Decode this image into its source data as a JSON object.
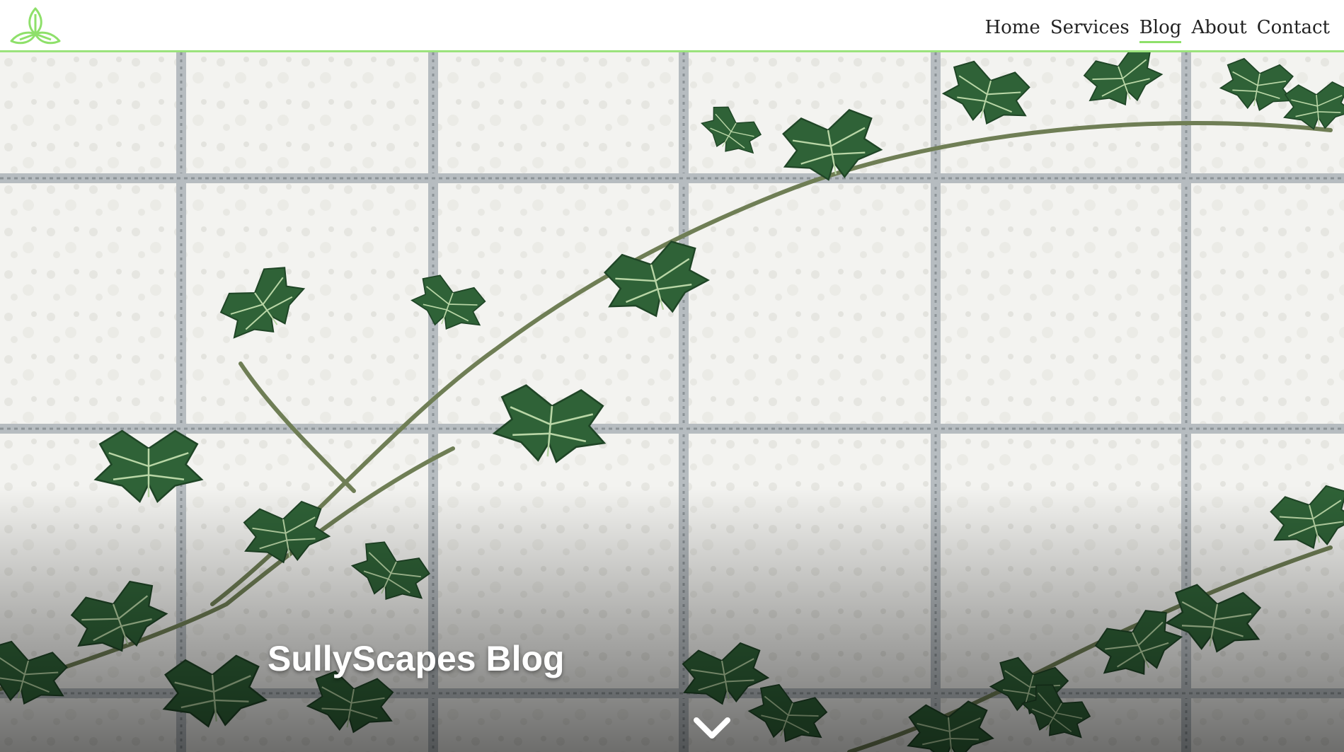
{
  "brand": {
    "logo_icon": "trefoil-leaf-icon",
    "accent_color": "#8ee06a"
  },
  "nav": {
    "items": [
      {
        "label": "Home",
        "active": false
      },
      {
        "label": "Services",
        "active": false
      },
      {
        "label": "Blog",
        "active": true
      },
      {
        "label": "About",
        "active": false
      },
      {
        "label": "Contact",
        "active": false
      }
    ]
  },
  "hero": {
    "title": "SullyScapes Blog",
    "scroll_icon": "chevron-down-icon",
    "background": "ivy-vine-on-wire-grid-photo"
  }
}
